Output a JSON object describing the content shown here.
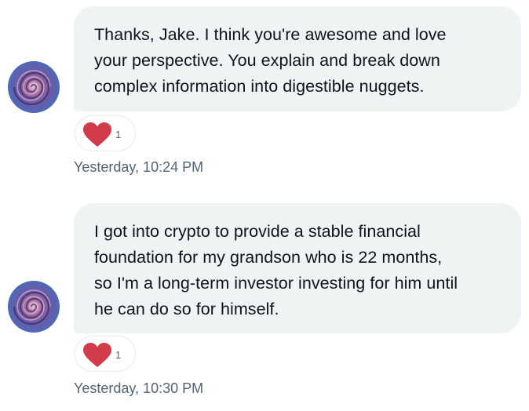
{
  "messages": [
    {
      "text": "Thanks, Jake. I think you're awesome and love\nyour perspective. You explain and break down\ncomplex information into digestible nuggets.",
      "reaction": {
        "icon": "heart-icon",
        "count": "1",
        "color": "#d13b4a"
      },
      "timestamp": "Yesterday, 10:24 PM"
    },
    {
      "text": "I got into crypto to provide a stable financial\nfoundation for my grandson who is 22 months,\nso I'm a long-term investor investing for him until\nhe can do so for himself.",
      "reaction": {
        "icon": "heart-icon",
        "count": "1",
        "color": "#d13b4a"
      },
      "timestamp": "Yesterday, 10:30 PM"
    }
  ],
  "colors": {
    "bubble": "#eff3f4",
    "text": "#0f1419",
    "secondary": "#536471"
  }
}
